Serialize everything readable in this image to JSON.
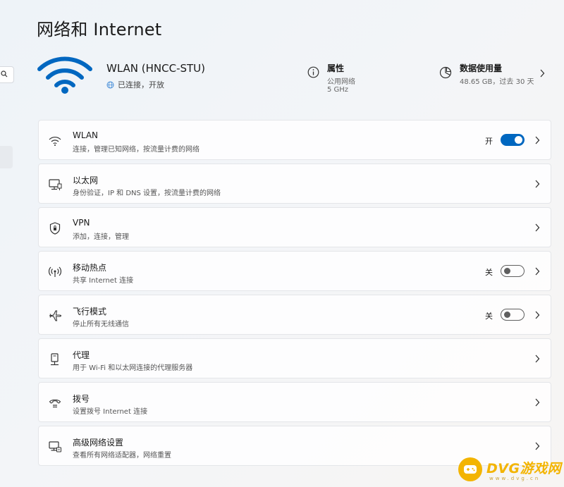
{
  "page_title": "网络和 Internet",
  "hero": {
    "name": "WLAN (HNCC-STU)",
    "status": "已连接，开放",
    "properties": {
      "title": "属性",
      "line1": "公用网络",
      "line2": "5 GHz"
    },
    "data_usage": {
      "title": "数据使用量",
      "value": "48.65 GB，过去 30 天"
    }
  },
  "rows": [
    {
      "label": "WLAN",
      "sub": "连接，管理已知网络，按流量计费的网络",
      "state": "开",
      "toggle": "on",
      "icon": "wifi-icon"
    },
    {
      "label": "以太网",
      "sub": "身份验证，IP 和 DNS 设置，按流量计费的网络",
      "icon": "ethernet-icon"
    },
    {
      "label": "VPN",
      "sub": "添加，连接，管理",
      "icon": "shield-icon"
    },
    {
      "label": "移动热点",
      "sub": "共享 Internet 连接",
      "state": "关",
      "toggle": "off",
      "icon": "hotspot-icon"
    },
    {
      "label": "飞行模式",
      "sub": "停止所有无线通信",
      "state": "关",
      "toggle": "off",
      "icon": "airplane-icon"
    },
    {
      "label": "代理",
      "sub": "用于 Wi-Fi 和以太网连接的代理服务器",
      "icon": "proxy-icon"
    },
    {
      "label": "拨号",
      "sub": "设置拨号 Internet 连接",
      "icon": "dialup-icon"
    },
    {
      "label": "高级网络设置",
      "sub": "查看所有网络适配器，网络重置",
      "icon": "network-pc-icon"
    }
  ],
  "watermark": {
    "text": "DVG游戏网",
    "sub": "www.dvg.cn"
  },
  "colors": {
    "accent": "#0067c0",
    "watermark": "#f3b400"
  }
}
